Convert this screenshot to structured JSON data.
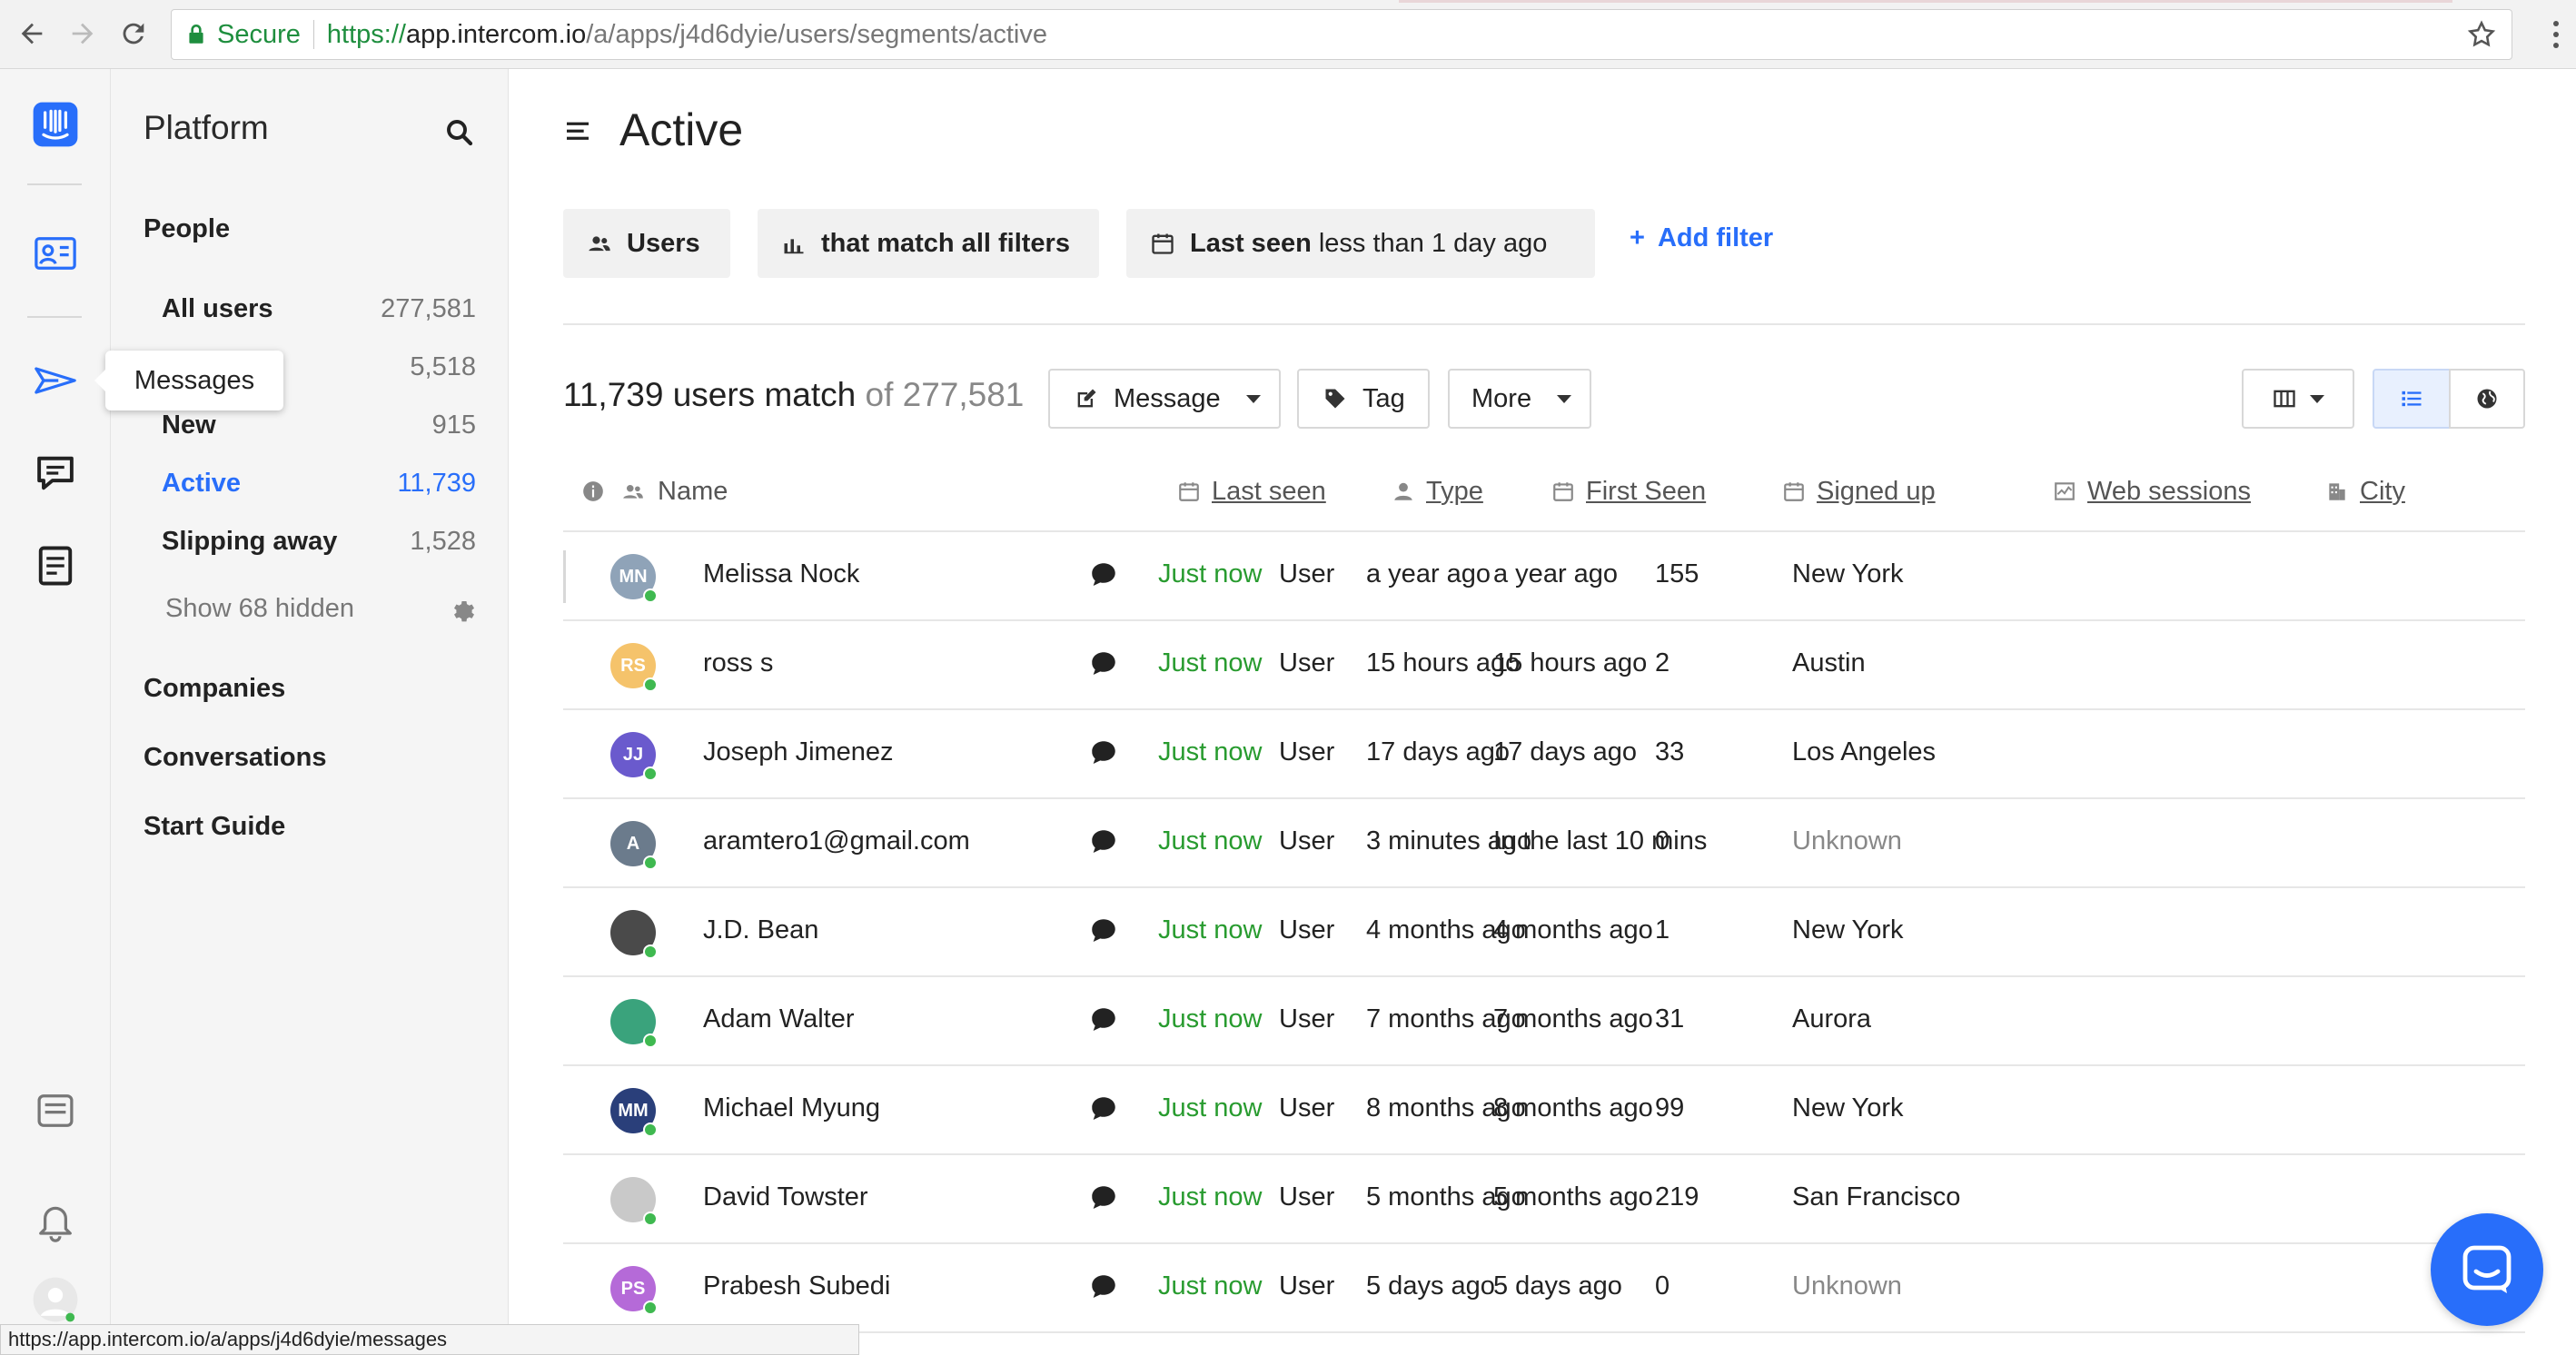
{
  "browser": {
    "secure_label": "Secure",
    "url_proto": "https://",
    "url_host": "app.intercom.io",
    "url_path": "/a/apps/j4d6dyie/users/segments/active",
    "status_url": "https://app.intercom.io/a/apps/j4d6dyie/messages"
  },
  "rail": {
    "tooltip": "Messages"
  },
  "sidebar": {
    "title": "Platform",
    "people_heading": "People",
    "segments": [
      {
        "label": "All users",
        "count": "277,581"
      },
      {
        "label": "",
        "count": "5,518"
      },
      {
        "label": "New",
        "count": "915"
      },
      {
        "label": "Active",
        "count": "11,739"
      },
      {
        "label": "Slipping away",
        "count": "1,528"
      }
    ],
    "show_hidden": "Show 68 hidden",
    "sections": [
      "Companies",
      "Conversations",
      "Start Guide"
    ]
  },
  "main": {
    "title": "Active",
    "filters": {
      "users": "Users",
      "match": "that match all filters",
      "last_seen_bold": "Last seen",
      "last_seen_rest": " less than 1 day ago",
      "add_filter": "Add filter",
      "add_plus": "+"
    },
    "match_count": "11,739 users match",
    "match_of": "of 277,581",
    "actions": {
      "message": "Message",
      "tag": "Tag",
      "more": "More"
    },
    "columns": {
      "name": "Name",
      "last_seen": "Last seen",
      "type": "Type",
      "first_seen": "First Seen",
      "signed_up": "Signed up",
      "web_sessions": "Web sessions",
      "city": "City"
    },
    "rows": [
      {
        "initials": "MN",
        "color": "#8fa3b8",
        "name": "Melissa Nock",
        "last_seen": "Just now",
        "type": "User",
        "first_seen": "a year ago",
        "signed_up": "a year ago",
        "sessions": "155",
        "city": "New York",
        "city_unknown": false
      },
      {
        "initials": "RS",
        "color": "#f5c36b",
        "name": "ross s",
        "last_seen": "Just now",
        "type": "User",
        "first_seen": "15 hours ago",
        "signed_up": "15 hours ago",
        "sessions": "2",
        "city": "Austin",
        "city_unknown": false
      },
      {
        "initials": "JJ",
        "color": "#6a5acd",
        "name": "Joseph Jimenez",
        "last_seen": "Just now",
        "type": "User",
        "first_seen": "17 days ago",
        "signed_up": "17 days ago",
        "sessions": "33",
        "city": "Los Angeles",
        "city_unknown": false
      },
      {
        "initials": "A",
        "color": "#6b7b8c",
        "name": "aramtero1@gmail.com",
        "last_seen": "Just now",
        "type": "User",
        "first_seen": "3 minutes ago",
        "signed_up": "In the last 10 mins",
        "sessions": "0",
        "city": "Unknown",
        "city_unknown": true
      },
      {
        "initials": "",
        "color": "#4a4a4a",
        "name": "J.D. Bean",
        "last_seen": "Just now",
        "type": "User",
        "first_seen": "4 months ago",
        "signed_up": "4 months ago",
        "sessions": "1",
        "city": "New York",
        "city_unknown": false
      },
      {
        "initials": "",
        "color": "#3aa37c",
        "name": "Adam Walter",
        "last_seen": "Just now",
        "type": "User",
        "first_seen": "7 months ago",
        "signed_up": "7 months ago",
        "sessions": "31",
        "city": "Aurora",
        "city_unknown": false
      },
      {
        "initials": "MM",
        "color": "#2a3f7a",
        "name": "Michael Myung",
        "last_seen": "Just now",
        "type": "User",
        "first_seen": "8 months ago",
        "signed_up": "8 months ago",
        "sessions": "99",
        "city": "New York",
        "city_unknown": false
      },
      {
        "initials": "",
        "color": "#c9c9c9",
        "name": "David Towster",
        "last_seen": "Just now",
        "type": "User",
        "first_seen": "5 months ago",
        "signed_up": "5 months ago",
        "sessions": "219",
        "city": "San Francisco",
        "city_unknown": false
      },
      {
        "initials": "PS",
        "color": "#b56ad8",
        "name": "Prabesh Subedi",
        "last_seen": "Just now",
        "type": "User",
        "first_seen": "5 days ago",
        "signed_up": "5 days ago",
        "sessions": "0",
        "city": "Unknown",
        "city_unknown": true
      }
    ]
  },
  "colors": {
    "accent": "#286efa",
    "green": "#289b2f",
    "online": "#3fb950"
  }
}
